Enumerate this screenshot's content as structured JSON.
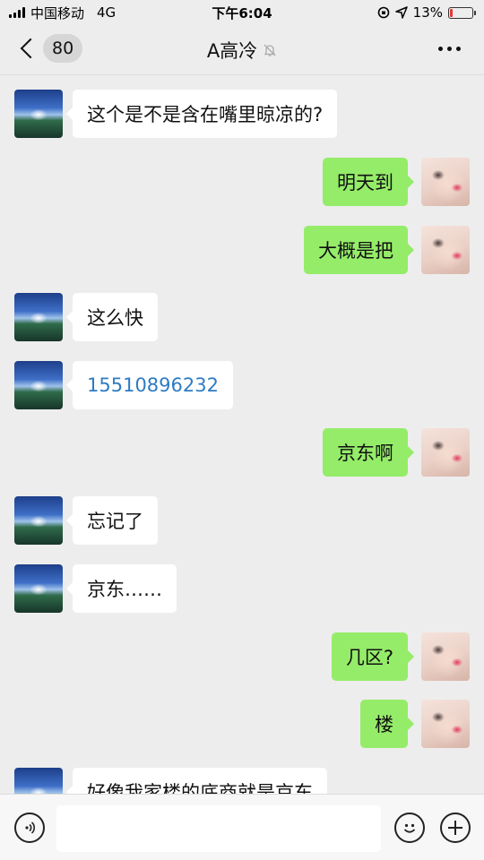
{
  "status_bar": {
    "carrier": "中国移动",
    "network": "4G",
    "time": "下午6:04",
    "battery_percent": "13%",
    "battery_level": 0.13,
    "battery_color": "#e53935"
  },
  "nav": {
    "unread_count": "80",
    "title": "A高冷",
    "icons": {
      "back": "chevron-left-icon",
      "mute": "bell-mute-icon",
      "more": "more-dots-icon"
    }
  },
  "colors": {
    "background": "#ededed",
    "sent_bubble": "#95ec69",
    "received_bubble": "#ffffff",
    "link": "#2e7bc4"
  },
  "messages": [
    {
      "side": "left",
      "text": "这个是不是含在嘴里晾凉的?"
    },
    {
      "side": "right",
      "text": "明天到"
    },
    {
      "side": "right",
      "text": "大概是把"
    },
    {
      "side": "left",
      "text": "这么快"
    },
    {
      "side": "left",
      "text": "15510896232",
      "link": true
    },
    {
      "side": "right",
      "text": "京东啊"
    },
    {
      "side": "left",
      "text": "忘记了"
    },
    {
      "side": "left",
      "text": "京东……"
    },
    {
      "side": "right",
      "text": "几区?"
    },
    {
      "side": "right",
      "text": "楼"
    },
    {
      "side": "left",
      "text": "好像我家楼的底商就是京东"
    }
  ],
  "input_bar": {
    "placeholder": "",
    "icons": {
      "voice": "voice-icon",
      "emoji": "emoji-icon",
      "plus": "plus-icon"
    }
  }
}
